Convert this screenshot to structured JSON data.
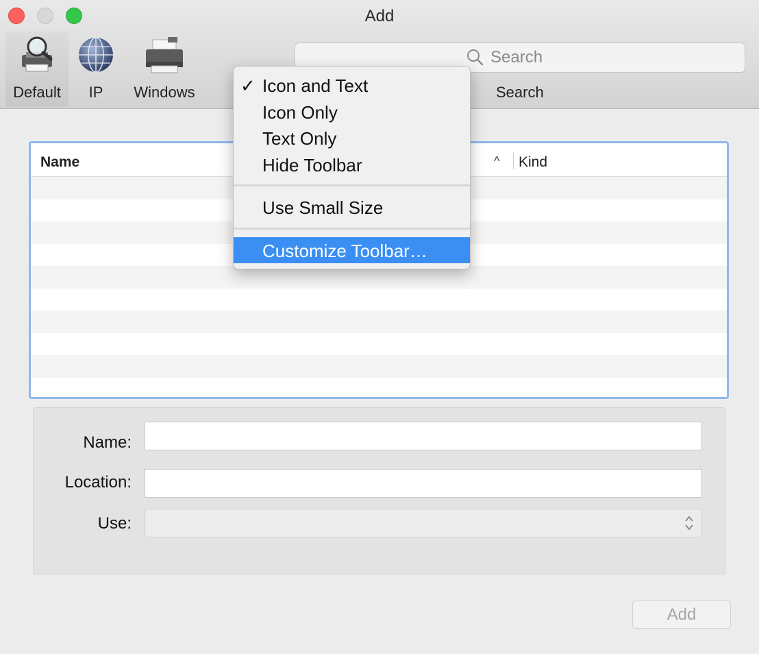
{
  "window": {
    "title": "Add"
  },
  "toolbar": {
    "items": [
      {
        "label": "Default",
        "icon": "printer-magnifier-icon"
      },
      {
        "label": "IP",
        "icon": "globe-icon"
      },
      {
        "label": "Windows",
        "icon": "printer-icon"
      }
    ],
    "search": {
      "placeholder": "Search",
      "label": "Search"
    }
  },
  "context_menu": {
    "items": [
      {
        "label": "Icon and Text",
        "checked": true
      },
      {
        "label": "Icon Only",
        "checked": false
      },
      {
        "label": "Text Only",
        "checked": false
      },
      {
        "label": "Hide Toolbar",
        "checked": false
      },
      {
        "label": "Use Small Size",
        "checked": false
      },
      {
        "label": "Customize Toolbar…",
        "highlighted": true
      }
    ],
    "check_mark": "✓"
  },
  "table": {
    "columns": [
      "Name",
      "Kind"
    ],
    "sort_indicator": "^"
  },
  "form": {
    "name_label": "Name:",
    "location_label": "Location:",
    "use_label": "Use:",
    "name_value": "",
    "location_value": "",
    "use_value": ""
  },
  "buttons": {
    "add": "Add"
  },
  "colors": {
    "accent": "#3b8ff2",
    "table_focus_ring": "#8fb7ef"
  }
}
